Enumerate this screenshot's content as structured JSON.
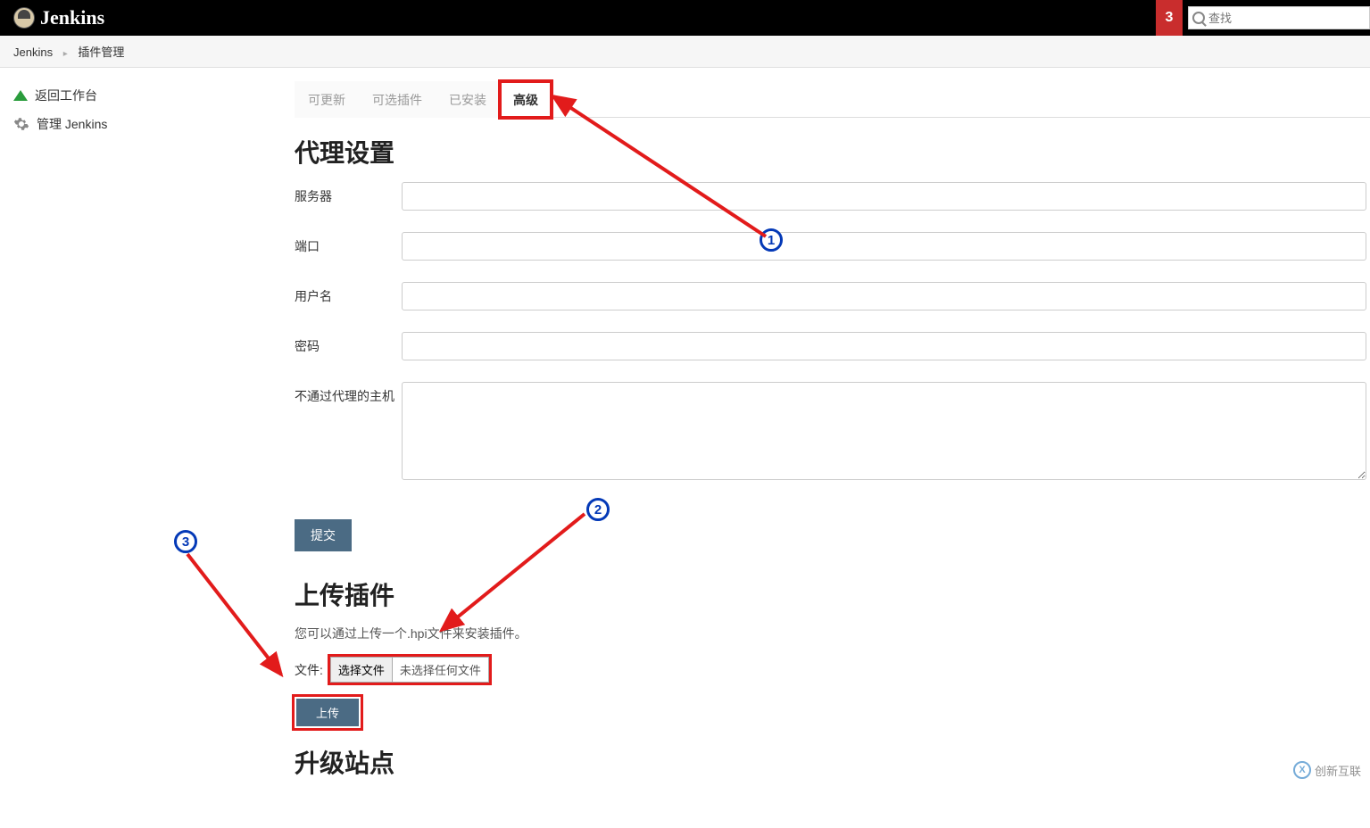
{
  "brand": "Jenkins",
  "header": {
    "notification_count": "3",
    "search_placeholder": "查找"
  },
  "breadcrumb": {
    "items": [
      "Jenkins",
      "插件管理"
    ]
  },
  "sidebar": {
    "items": [
      {
        "label": "返回工作台"
      },
      {
        "label": "管理 Jenkins"
      }
    ]
  },
  "tabs": {
    "items": [
      "可更新",
      "可选插件",
      "已安装",
      "高级"
    ],
    "active_index": 3,
    "highlighted_index": 3
  },
  "proxy_section": {
    "title": "代理设置",
    "fields": {
      "server_label": "服务器",
      "port_label": "端口",
      "username_label": "用户名",
      "password_label": "密码",
      "no_proxy_label": "不通过代理的主机"
    },
    "submit_label": "提交"
  },
  "upload_section": {
    "title": "上传插件",
    "description": "您可以通过上传一个.hpi文件来安装插件。",
    "file_label": "文件:",
    "choose_file_label": "选择文件",
    "no_file_text": "未选择任何文件",
    "upload_button": "上传"
  },
  "upgrade_section": {
    "title": "升级站点"
  },
  "annotations": {
    "n1": "1",
    "n2": "2",
    "n3": "3"
  },
  "watermark": "创新互联"
}
